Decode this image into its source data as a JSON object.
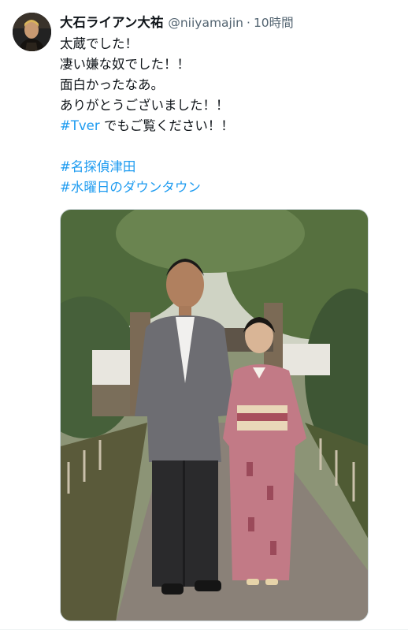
{
  "tweet": {
    "author": {
      "display_name": "大石ライアン大祐",
      "handle": "@niiyamajin",
      "separator": "·",
      "time": "10時間"
    },
    "lines": {
      "l1": "太蔵でした！",
      "l2": "凄い嫌な奴でした！！",
      "l3": "面白かったなあ。",
      "l4": "ありがとうございました！！",
      "l5_tag": "#Tver",
      "l5_rest": " でもご覧ください！！",
      "tag1": "#名探偵津田",
      "tag2": "#水曜日のダウンタウン"
    },
    "avatar_icon": "profile-photo",
    "photo_icon": "photo-man-and-woman-in-kimono",
    "colors": {
      "hashtag": "#1d9bf0",
      "secondary_text": "#536471",
      "primary_text": "#0f1419"
    }
  }
}
